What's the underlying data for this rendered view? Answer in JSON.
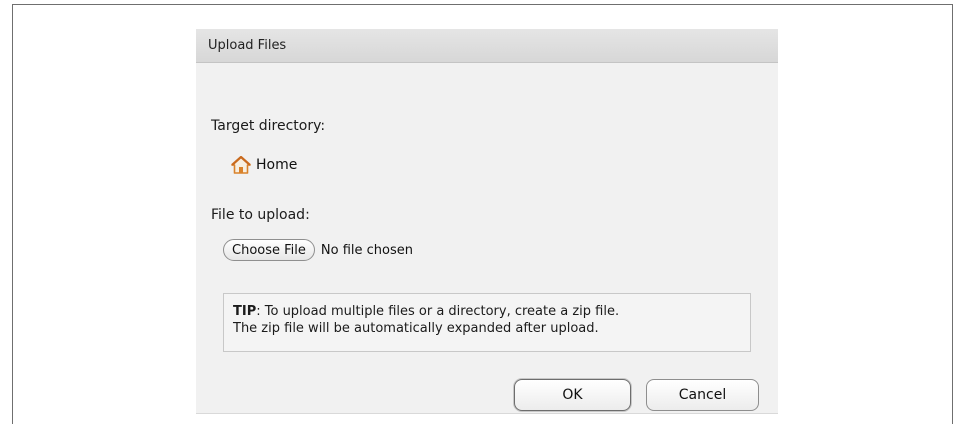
{
  "dialog": {
    "title": "Upload Files",
    "target_label": "Target directory:",
    "target_dir": "Home",
    "file_label": "File to upload:",
    "choose_file_label": "Choose File",
    "no_file_text": "No file chosen",
    "tip_label": "TIP",
    "tip_text_line1": ": To upload multiple files or a directory, create a zip file.",
    "tip_text_line2": "The zip file will be automatically expanded after upload.",
    "ok_label": "OK",
    "cancel_label": "Cancel"
  },
  "icons": {
    "home": "home-icon"
  },
  "colors": {
    "home_icon": "#d9822b",
    "dialog_bg": "#f1f1f1",
    "titlebar_bg": "#dcdcdc"
  }
}
